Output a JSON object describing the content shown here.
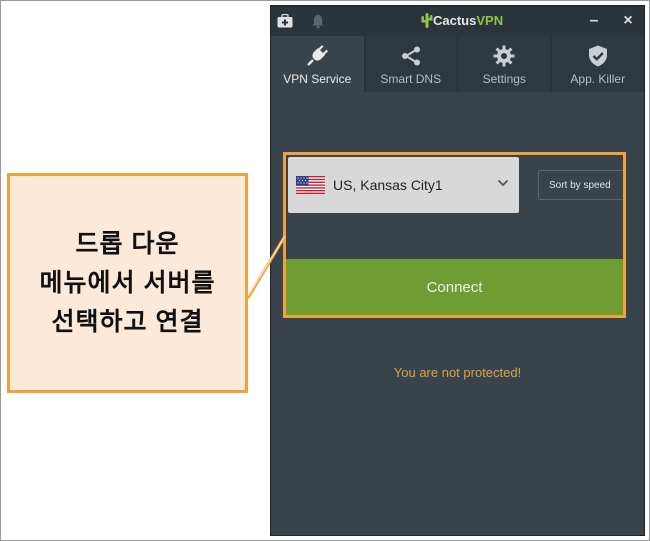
{
  "app": {
    "brand_prefix": "Cactus",
    "brand_suffix": "VPN",
    "minimize": "–",
    "close": "×"
  },
  "tabs": [
    {
      "label": "VPN Service",
      "icon": "plug-icon",
      "active": true
    },
    {
      "label": "Smart DNS",
      "icon": "share-icon",
      "active": false
    },
    {
      "label": "Settings",
      "icon": "gear-icon",
      "active": false
    },
    {
      "label": "App. Killer",
      "icon": "shield-check-icon",
      "active": false
    }
  ],
  "server": {
    "selected": "US, Kansas City1",
    "flag": "us-flag-icon"
  },
  "sort_label": "Sort by speed",
  "connect_label": "Connect",
  "status_text": "You are not protected!",
  "callout": {
    "lines": [
      "드롭 다운",
      "메뉴에서 서버를",
      "선택하고 연결"
    ]
  },
  "colors": {
    "accent": "#f0a23a",
    "connect": "#6f9d33",
    "status": "#d9a441",
    "brand_green": "#8fc43f"
  }
}
